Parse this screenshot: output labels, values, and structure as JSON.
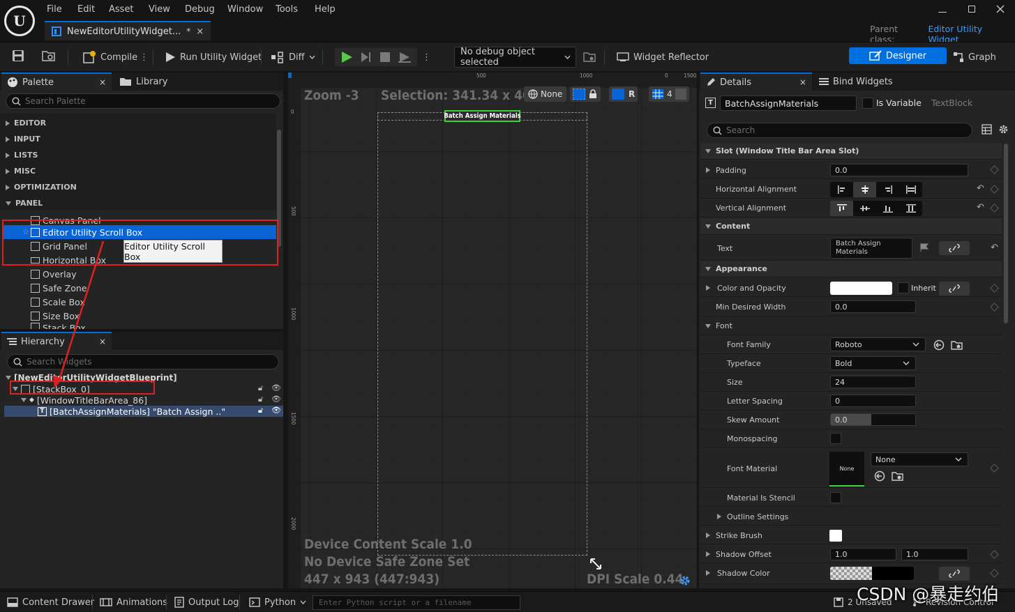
{
  "title": {
    "document_tab": "NewEditorUtilityWidget...",
    "unsaved_marker": "*",
    "close": "×",
    "parent_class_label": "Parent class:",
    "parent_class_value": "Editor Utility Widget"
  },
  "menu": [
    "File",
    "Edit",
    "Asset",
    "View",
    "Debug",
    "Window",
    "Tools",
    "Help"
  ],
  "toolbar": {
    "compile": "Compile",
    "run": "Run Utility Widget",
    "diff": "Diff",
    "debug_select": "No debug object selected",
    "reflector": "Widget Reflector",
    "designer": "Designer",
    "graph": "Graph"
  },
  "palette": {
    "tab": "Palette",
    "library_tab": "Library",
    "search_placeholder": "Search Palette",
    "categories": [
      "EDITOR",
      "INPUT",
      "LISTS",
      "MISC",
      "OPTIMIZATION",
      "PANEL"
    ],
    "items": [
      "Canvas Panel",
      "Editor Utility Scroll Box",
      "Grid Panel",
      "Horizontal Box",
      "Overlay",
      "Safe Zone",
      "Scale Box",
      "Size Box",
      "Stack Box"
    ],
    "tooltip": "Editor Utility Scroll Box"
  },
  "hierarchy": {
    "tab": "Hierarchy",
    "search_placeholder": "Search Widgets",
    "root": "[NewEditorUtilityWidgetBlueprint]",
    "nodes": [
      "[StackBox_0]",
      "[WindowTitleBarArea_86]",
      "[BatchAssignMaterials] \"Batch Assign ..\""
    ]
  },
  "canvas": {
    "zoom": "Zoom -3",
    "selection": "Selection: 341.34 x 40.04",
    "none_label": "None",
    "r_label": "R",
    "grid_label": "4",
    "ruler_top": [
      "0",
      "500",
      "1000",
      "1500"
    ],
    "ruler_left": [
      "0",
      "500",
      "1000",
      "1500",
      "2000"
    ],
    "widget_text": "Batch Assign Materials",
    "device_scale": "Device Content Scale 1.0",
    "safe_zone": "No Device Safe Zone Set",
    "resolution": "447 x 943 (447:943)",
    "dpi": "DPI Scale 0.44"
  },
  "details": {
    "tab": "Details",
    "bind_tab": "Bind Widgets",
    "widget_name": "BatchAssignMaterials",
    "is_variable": "Is Variable",
    "type": "TextBlock",
    "search_placeholder": "Search",
    "slot_section": "Slot (Window Title Bar Area Slot)",
    "padding_label": "Padding",
    "padding_value": "0.0",
    "halign_label": "Horizontal Alignment",
    "valign_label": "Vertical Alignment",
    "content_section": "Content",
    "text_label": "Text",
    "text_value_line1": "Batch Assign",
    "text_value_line2": "Materials",
    "appearance_section": "Appearance",
    "color_label": "Color and Opacity",
    "inherit": "Inherit",
    "min_width_label": "Min Desired Width",
    "min_width_value": "0.0",
    "font_label": "Font",
    "font_family_label": "Font Family",
    "font_family_value": "Roboto",
    "typeface_label": "Typeface",
    "typeface_value": "Bold",
    "size_label": "Size",
    "size_value": "24",
    "letter_spacing_label": "Letter Spacing",
    "letter_spacing_value": "0",
    "skew_label": "Skew Amount",
    "skew_value": "0.0",
    "monospacing_label": "Monospacing",
    "font_material_label": "Font Material",
    "font_material_thumb": "None",
    "font_material_value": "None",
    "stencil_label": "Material Is Stencil",
    "outline_label": "Outline Settings",
    "strike_label": "Strike Brush",
    "shadow_offset_label": "Shadow Offset",
    "shadow_offset_x": "1.0",
    "shadow_offset_y": "1.0",
    "shadow_color_label": "Shadow Color"
  },
  "statusbar": {
    "content_drawer": "Content Drawer",
    "animations": "Animations",
    "output_log": "Output Log",
    "python": "Python",
    "python_placeholder": "Enter Python script or a filename",
    "unsaved": "2 Unsaved",
    "revision": "Revision Control"
  },
  "watermark": "CSDN @暴走约伯",
  "colors": {
    "accent": "#0070e0",
    "selection": "#0a64d6",
    "annotation": "#e02020",
    "widget_outline": "#3cd23c"
  }
}
